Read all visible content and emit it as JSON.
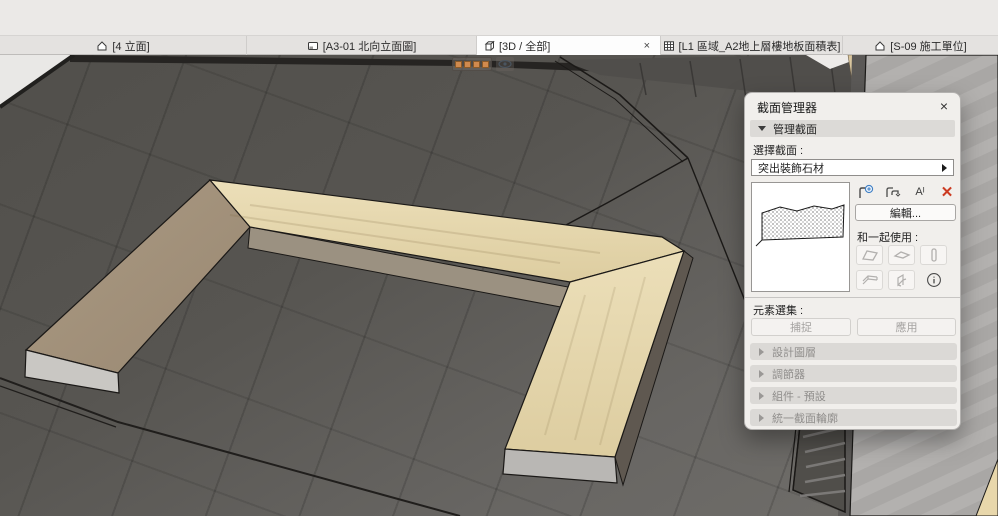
{
  "tab_bar": {
    "tabs": [
      {
        "label": "[4 立面]"
      },
      {
        "label": "[A3-01 北向立面圖]"
      },
      {
        "label": "[3D / 全部]",
        "close": "×"
      },
      {
        "label": "[L1 區域_A2地上層樓地板面積表]"
      },
      {
        "label": "[S-09 施工單位]"
      }
    ]
  },
  "section_manager": {
    "title": "截面管理器",
    "close": "×",
    "manage_section_header": "管理截面",
    "select_section_label": "選擇截面 :",
    "profile_dropdown_value": "突出裝飾石材",
    "rename_icon_label": "Aᴵ",
    "edit_button": "編輯...",
    "use_with_label": "和一起使用 :",
    "element_selection_label": "元素選集 :",
    "capture_button": "捕捉",
    "apply_button": "應用",
    "collapsed_sections": [
      {
        "label": "設計圖層"
      },
      {
        "label": "調節器"
      },
      {
        "label": "組件 - 預設"
      },
      {
        "label": "統一截面輪廓"
      }
    ]
  },
  "colors": {
    "delete_red": "#cc3b22",
    "add_blue": "#3f7fc4",
    "wood_light": "#e7d8af",
    "wood_dark": "#a3927b",
    "ground_dark": "#53514d",
    "ground_light": "#6e6c68"
  }
}
